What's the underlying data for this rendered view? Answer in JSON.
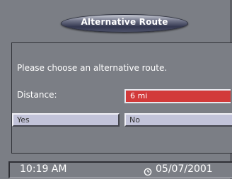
{
  "header": {
    "title": "Alternative Route"
  },
  "dialog": {
    "prompt": "Please choose an alternative route.",
    "distance_label": "Distance:",
    "distance_value": "6 mi",
    "yes_label": "Yes",
    "no_label": "No"
  },
  "status": {
    "time": "10:19 AM",
    "date": "05/07/2001",
    "date_icon": "clock-icon"
  },
  "colors": {
    "highlight": "#d23a3a",
    "button_bg": "#c2c3d9",
    "background": "#7b7e85"
  }
}
